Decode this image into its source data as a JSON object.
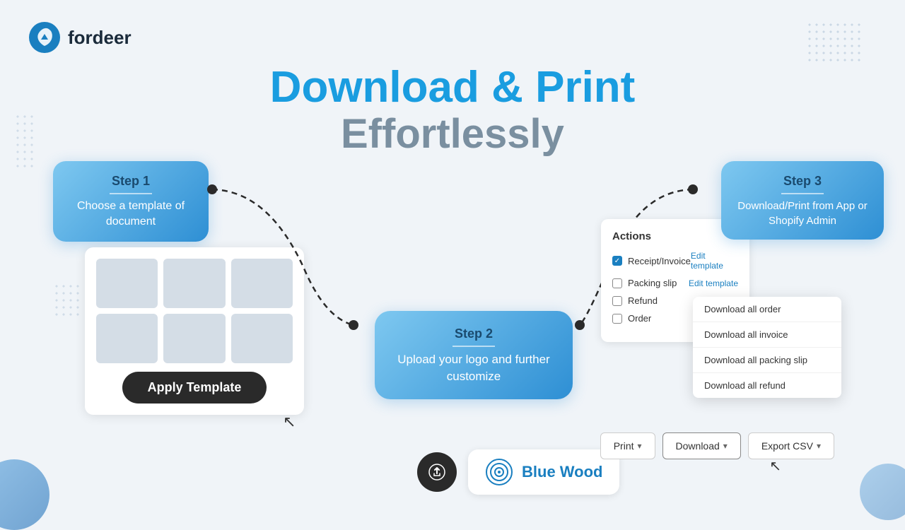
{
  "brand": {
    "name": "fordeer",
    "logo_alt": "fordeer logo"
  },
  "page": {
    "title_line1": "Download & Print",
    "title_line2": "Effortlessly"
  },
  "steps": {
    "step1": {
      "label": "Step 1",
      "description": "Choose a template of document"
    },
    "step2": {
      "label": "Step 2",
      "description": "Upload your logo and further customize"
    },
    "step3": {
      "label": "Step 3",
      "description": "Download/Print from App or Shopify Admin"
    }
  },
  "apply_btn": "Apply Template",
  "actions": {
    "title": "Actions",
    "items": [
      {
        "name": "Receipt/Invoice",
        "checked": true,
        "edit_label": "Edit template"
      },
      {
        "name": "Packing slip",
        "checked": false,
        "edit_label": "Edit template"
      },
      {
        "name": "Refund",
        "checked": false
      },
      {
        "name": "Order",
        "checked": false
      }
    ]
  },
  "download_menu": {
    "items": [
      "Download all order",
      "Download all invoice",
      "Download all packing slip",
      "Download all refund"
    ]
  },
  "bottom_buttons": {
    "print_label": "Print",
    "download_label": "Download",
    "export_label": "Export CSV"
  },
  "blue_wood": {
    "name": "Blue Wood"
  }
}
